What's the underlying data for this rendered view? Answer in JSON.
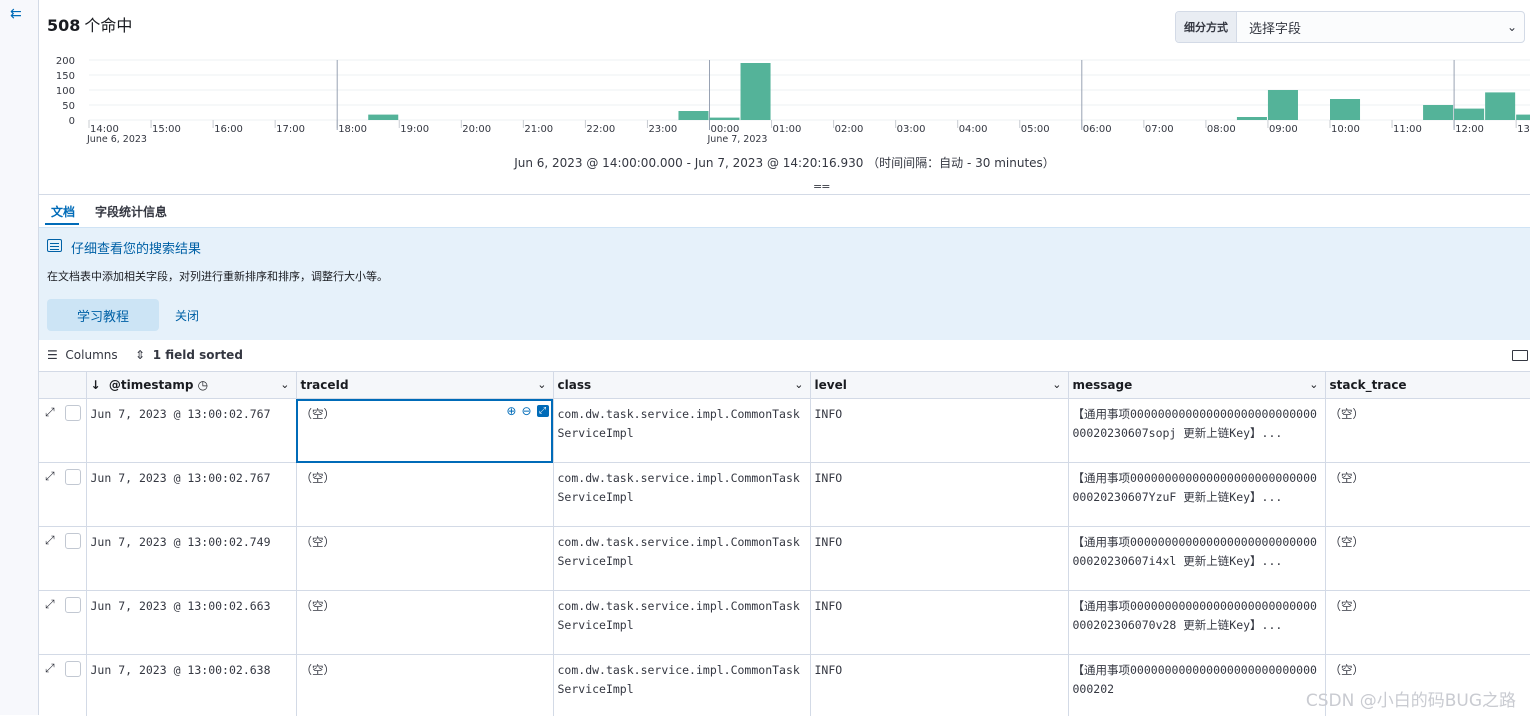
{
  "left_rail": {
    "collapse_icon": "collapse-arrow-icon"
  },
  "hits": {
    "count": "508",
    "unit": "个命中"
  },
  "breakdown": {
    "label": "细分方式",
    "placeholder": "选择字段"
  },
  "chart_data": {
    "type": "bar",
    "ylim": [
      0,
      200
    ],
    "y_ticks": [
      "200",
      "150",
      "100",
      "50",
      "0"
    ],
    "x_ticks": [
      "14:00",
      "15:00",
      "16:00",
      "17:00",
      "18:00",
      "19:00",
      "20:00",
      "21:00",
      "22:00",
      "23:00",
      "00:00",
      "01:00",
      "02:00",
      "03:00",
      "04:00",
      "05:00",
      "06:00",
      "07:00",
      "08:00",
      "09:00",
      "10:00",
      "11:00",
      "12:00",
      "13:00"
    ],
    "date_labels": [
      {
        "tick": "14:00",
        "text": "June 6, 2023"
      },
      {
        "tick": "00:00",
        "text": "June 7, 2023"
      }
    ],
    "bar_color": "#54b399",
    "bars": [
      {
        "x": "18:30",
        "value": 18
      },
      {
        "x": "23:30",
        "value": 30
      },
      {
        "x": "00:00",
        "value": 8
      },
      {
        "x": "00:30",
        "value": 190
      },
      {
        "x": "08:30",
        "value": 10
      },
      {
        "x": "09:00",
        "value": 100
      },
      {
        "x": "10:00",
        "value": 70
      },
      {
        "x": "11:30",
        "value": 50
      },
      {
        "x": "12:00",
        "value": 38
      },
      {
        "x": "12:30",
        "value": 92
      },
      {
        "x": "13:00",
        "value": 18
      }
    ],
    "grid": true
  },
  "time_range": "Jun 6, 2023 @ 14:00:00.000 - Jun 7, 2023 @ 14:20:16.930 （时间间隔：自动 - 30 minutes）",
  "resize_handle": "==",
  "tabs": [
    {
      "label": "文档",
      "active": true
    },
    {
      "label": "字段统计信息",
      "active": false
    }
  ],
  "callout": {
    "title": "仔细查看您的搜索结果",
    "body": "在文档表中添加相关字段，对列进行重新排序和排序，调整行大小等。",
    "learn_button": "学习教程",
    "close_button": "关闭"
  },
  "toolbar": {
    "columns": "Columns",
    "sorted": "1 field sorted"
  },
  "columns": [
    {
      "label": "@timestamp"
    },
    {
      "label": "traceId"
    },
    {
      "label": "class"
    },
    {
      "label": "level"
    },
    {
      "label": "message"
    },
    {
      "label": "stack_trace"
    }
  ],
  "rows": [
    {
      "timestamp": "Jun 7, 2023 @ 13:00:02.767",
      "traceId": "（空）",
      "class": "com.dw.task.service.impl.CommonTaskServiceImpl",
      "level": "INFO",
      "message": "【通用事项00000000000000000000000000000020230607sopj 更新上链Key】...",
      "stack_trace": "（空）"
    },
    {
      "timestamp": "Jun 7, 2023 @ 13:00:02.767",
      "traceId": "（空）",
      "class": "com.dw.task.service.impl.CommonTaskServiceImpl",
      "level": "INFO",
      "message": "【通用事项00000000000000000000000000000020230607YzuF 更新上链Key】...",
      "stack_trace": "（空）"
    },
    {
      "timestamp": "Jun 7, 2023 @ 13:00:02.749",
      "traceId": "（空）",
      "class": "com.dw.task.service.impl.CommonTaskServiceImpl",
      "level": "INFO",
      "message": "【通用事项00000000000000000000000000000020230607i4xl 更新上链Key】...",
      "stack_trace": "（空）"
    },
    {
      "timestamp": "Jun 7, 2023 @ 13:00:02.663",
      "traceId": "（空）",
      "class": "com.dw.task.service.impl.CommonTaskServiceImpl",
      "level": "INFO",
      "message": "【通用事项000000000000000000000000000000202306070v28 更新上链Key】...",
      "stack_trace": "（空）"
    },
    {
      "timestamp": "Jun 7, 2023 @ 13:00:02.638",
      "traceId": "（空）",
      "class": "com.dw.task.service.impl.CommonTaskServiceImpl",
      "level": "INFO",
      "message": "【通用事项000000000000000000000000000000202",
      "stack_trace": "（空）"
    }
  ],
  "watermark": "CSDN @小白的码BUG之路"
}
